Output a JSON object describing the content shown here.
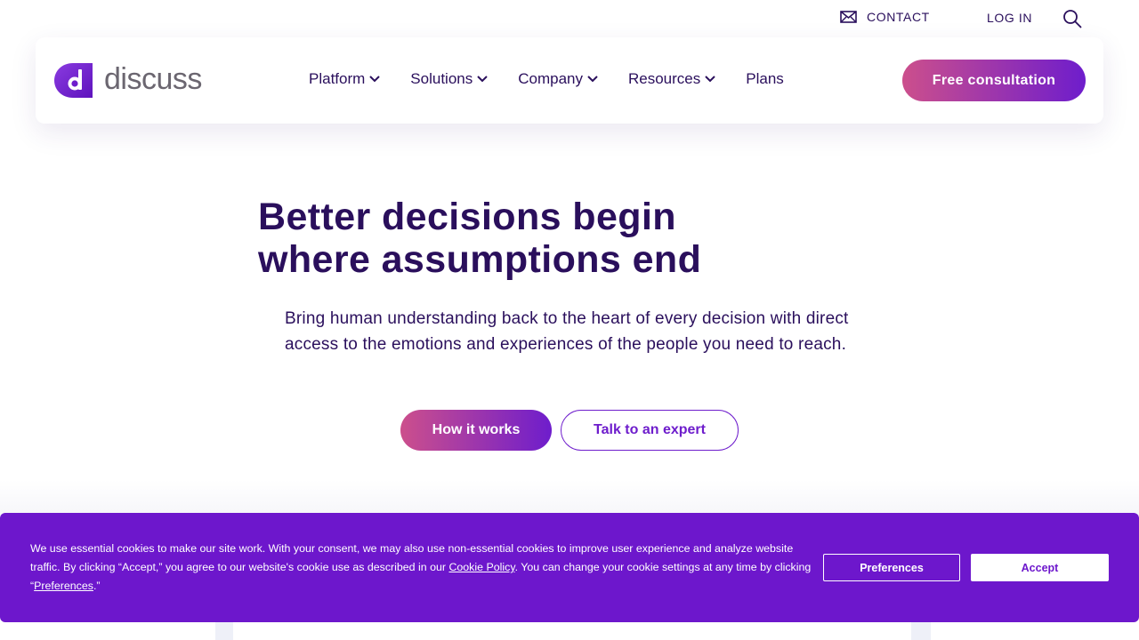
{
  "utility": {
    "contact_label": "CONTACT",
    "login_label": "LOG IN"
  },
  "header": {
    "logo_text": "discuss",
    "menu": [
      {
        "label": "Platform",
        "has_dropdown": true
      },
      {
        "label": "Solutions",
        "has_dropdown": true
      },
      {
        "label": "Company",
        "has_dropdown": true
      },
      {
        "label": "Resources",
        "has_dropdown": true
      },
      {
        "label": "Plans",
        "has_dropdown": false
      }
    ],
    "cta_label": "Free consultation"
  },
  "hero": {
    "title_line1": "Better decisions begin",
    "title_line2": "where assumptions end",
    "subtitle": "Bring human understanding back to the heart of every decision with direct access to the emotions and experiences of the people you need to reach.",
    "primary_button": "How it works",
    "secondary_button": "Talk to an expert"
  },
  "cookie_banner": {
    "text_part1": "We use essential cookies to make our site work. With your consent, we may also use non-essential cookies to improve user experience and analyze website traffic. By clicking “Accept,” you agree to our website's cookie use as described in our ",
    "cookie_policy_link": "Cookie Policy",
    "text_part2": ". You can change your cookie settings at any time by clicking “",
    "preferences_link": "Preferences",
    "text_part3": ".”",
    "preferences_button": "Preferences",
    "accept_button": "Accept"
  },
  "colors": {
    "brand_purple": "#6e1dcc",
    "brand_pink": "#cc4f8c",
    "text_dark": "#2a0f5c",
    "cookie_bg": "#6d17cc"
  },
  "icons": {
    "contact": "envelope-icon",
    "search": "search-icon",
    "dropdown": "chevron-down-icon"
  }
}
